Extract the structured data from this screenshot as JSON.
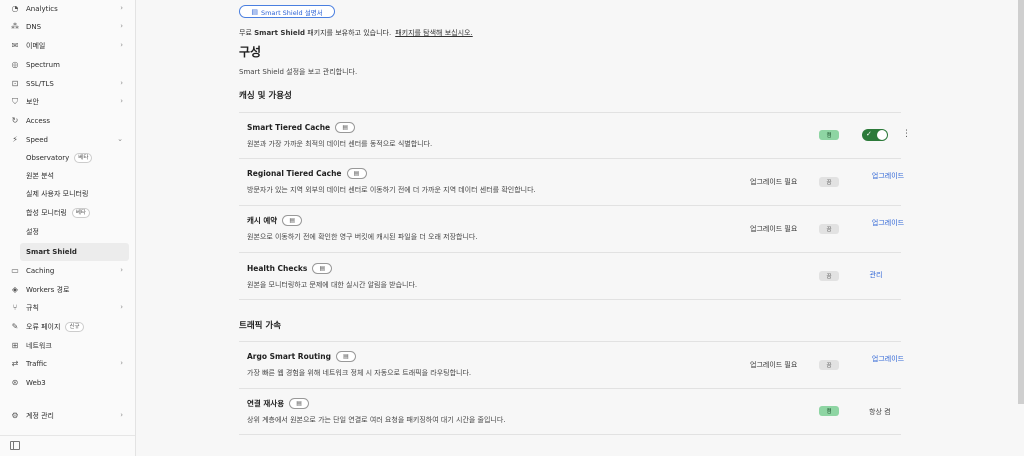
{
  "sidebar": {
    "items": [
      {
        "label": "Analytics",
        "icon": "analytics-icon",
        "chev": true
      },
      {
        "label": "DNS",
        "icon": "dns-icon",
        "chev": true
      },
      {
        "label": "이메일",
        "icon": "email-icon",
        "chev": true
      },
      {
        "label": "Spectrum",
        "icon": "spectrum-icon",
        "chev": false
      },
      {
        "label": "SSL/TLS",
        "icon": "lock-icon",
        "chev": true
      },
      {
        "label": "보안",
        "icon": "shield-icon",
        "chev": true
      },
      {
        "label": "Access",
        "icon": "access-icon",
        "chev": false
      },
      {
        "label": "Speed",
        "icon": "speed-icon",
        "chev": true
      }
    ],
    "speed_sub": [
      {
        "label": "Observatory",
        "badge": "베타"
      },
      {
        "label": "원본 분석",
        "badge": ""
      },
      {
        "label": "실제 사용자 모니터링",
        "badge": ""
      },
      {
        "label": "합성 모니터링",
        "badge": "베타"
      },
      {
        "label": "설정",
        "badge": ""
      },
      {
        "label": "Smart Shield",
        "badge": ""
      }
    ],
    "items2": [
      {
        "label": "Caching",
        "icon": "caching-icon",
        "chev": true
      },
      {
        "label": "Workers 경로",
        "icon": "workers-icon",
        "chev": false
      },
      {
        "label": "규칙",
        "icon": "rules-icon",
        "chev": true
      },
      {
        "label": "오류 페이지",
        "icon": "error-page-icon",
        "chev": false,
        "badge": "신규"
      },
      {
        "label": "네트워크",
        "icon": "network-icon",
        "chev": false
      },
      {
        "label": "Traffic",
        "icon": "traffic-icon",
        "chev": true
      },
      {
        "label": "Web3",
        "icon": "web3-icon",
        "chev": false
      }
    ],
    "account": {
      "label": "계정 관리",
      "icon": "gear-icon"
    }
  },
  "main": {
    "doc_button": "Smart Shield 설명서",
    "free_prefix": "무료 ",
    "free_bold": "Smart Shield",
    "free_suffix": " 패키지를 보유하고 있습니다.",
    "free_link": "패키지를 탐색해 보십시오.",
    "title": "구성",
    "subtitle": "Smart Shield 설정을 보고 관리합니다.",
    "section1": "캐싱 및 가용성",
    "section2": "트래픽 가속",
    "rows": [
      {
        "title": "Smart Tiered Cache",
        "desc": "원본과 가장 가까운 최적의 데이터 센터를 동적으로 식별합니다.",
        "status": "켬",
        "upgrade": "",
        "action": "",
        "toggle": true
      },
      {
        "title": "Regional Tiered Cache",
        "desc": "방문자가 있는 지역 외부의 데이터 센터로 이동하기 전에 더 가까운 지역 데이터 센터를 확인합니다.",
        "status": "끔",
        "upgrade": "업그레이드 필요",
        "action": "업그레이드"
      },
      {
        "title": "캐시 예약",
        "desc": "원본으로 이동하기 전에 확인한 영구 버킷에 캐시된 파일을 더 오래 저장합니다.",
        "status": "끔",
        "upgrade": "업그레이드 필요",
        "action": "업그레이드"
      },
      {
        "title": "Health Checks",
        "desc": "원본을 모니터링하고 문제에 대한 실시간 알림을 받습니다.",
        "status": "끔",
        "upgrade": "",
        "action": "관리"
      },
      {
        "title": "Argo Smart Routing",
        "desc": "가장 빠른 웹 경험을 위해 네트워크 정체 시 자동으로 트래픽을 라우팅합니다.",
        "status": "끔",
        "upgrade": "업그레이드 필요",
        "action": "업그레이드"
      },
      {
        "title": "연결 재사용",
        "desc": "상위 계층에서 원본으로 가는 단일 연결로 여러 요청을 패키징하여 대기 시간을 줄입니다.",
        "status": "켬",
        "upgrade": "",
        "action": "항상 켬"
      }
    ]
  }
}
